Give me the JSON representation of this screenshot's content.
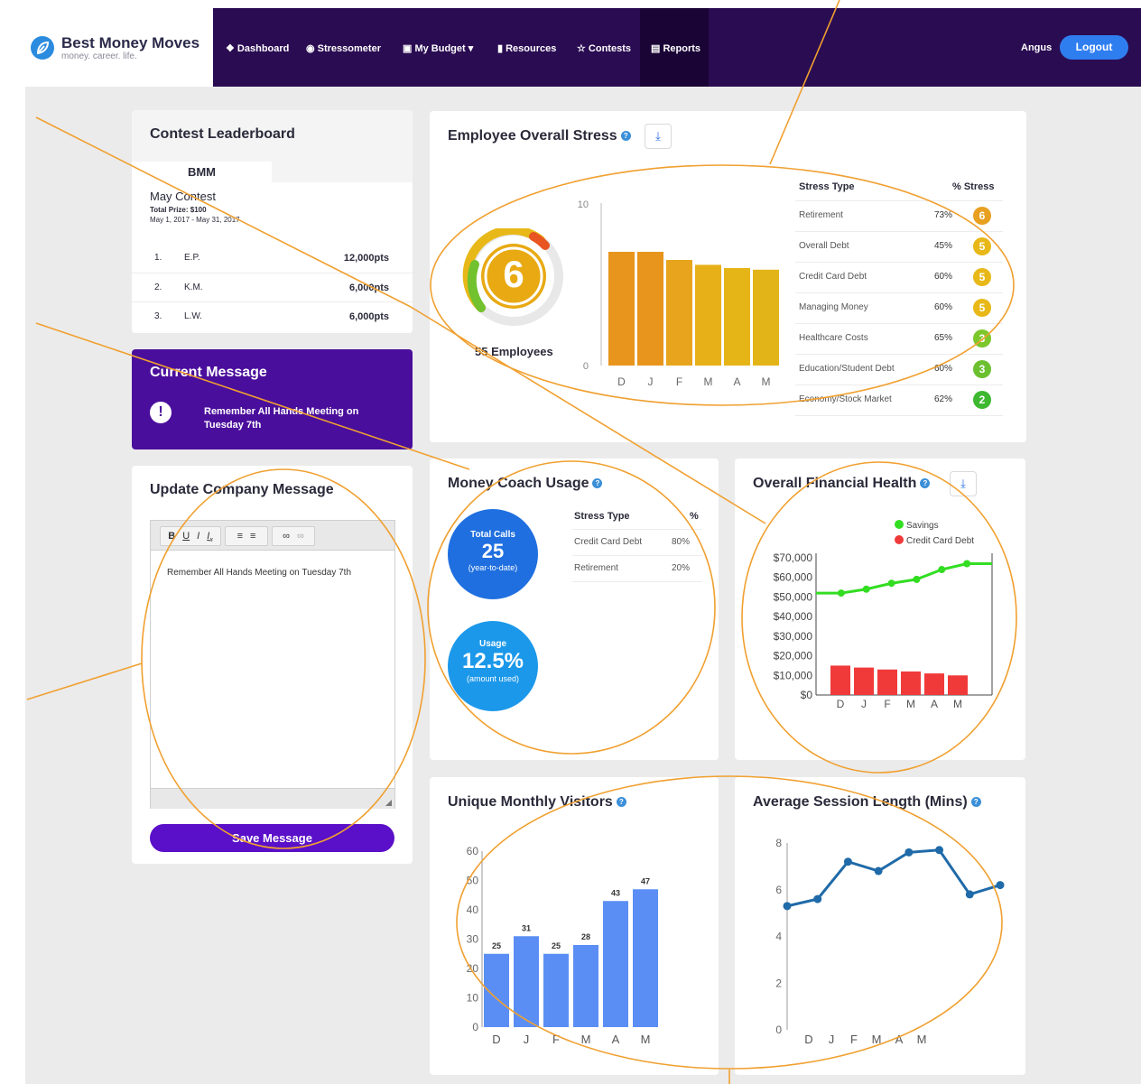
{
  "brand": {
    "name": "Best Money Moves",
    "tagline": "money. career. life."
  },
  "nav": {
    "items": [
      "Dashboard",
      "Stressometer",
      "My Budget",
      "Resources",
      "Contests",
      "Reports"
    ],
    "user": "Angus",
    "logout": "Logout"
  },
  "leaderboard": {
    "title": "Contest Leaderboard",
    "tab": "BMM",
    "contest_name": "May Contest",
    "prize": "Total Prize: $100",
    "dates": "May 1, 2017 - May 31, 2017",
    "rows": [
      {
        "rank": "1.",
        "name": "E.P.",
        "pts": "12,000pts"
      },
      {
        "rank": "2.",
        "name": "K.M.",
        "pts": "6,000pts"
      },
      {
        "rank": "3.",
        "name": "L.W.",
        "pts": "6,000pts"
      }
    ]
  },
  "current_message": {
    "title": "Current Message",
    "text": "Remember All Hands Meeting on Tuesday 7th"
  },
  "update_message": {
    "title": "Update Company Message",
    "toolbar": [
      "B",
      "U",
      "I",
      "Ix",
      "ol",
      "ul",
      "link",
      "unlink"
    ],
    "body": "Remember All Hands Meeting on Tuesday 7th",
    "save": "Save Message"
  },
  "stress": {
    "title": "Employee Overall Stress",
    "score": "6",
    "employees": "55 Employees",
    "table_headers": {
      "type": "Stress Type",
      "pct": "% Stress"
    },
    "rows": [
      {
        "type": "Retirement",
        "pct": "73%",
        "level": "6",
        "color": "#e8a020"
      },
      {
        "type": "Overall Debt",
        "pct": "45%",
        "level": "5",
        "color": "#e8b818"
      },
      {
        "type": "Credit Card Debt",
        "pct": "60%",
        "level": "5",
        "color": "#e8b818"
      },
      {
        "type": "Managing Money",
        "pct": "60%",
        "level": "5",
        "color": "#e8b818"
      },
      {
        "type": "Healthcare Costs",
        "pct": "65%",
        "level": "3",
        "color": "#7cc72c"
      },
      {
        "type": "Education/Student Debt",
        "pct": "60%",
        "level": "3",
        "color": "#6cc030"
      },
      {
        "type": "Economy/Stock Market",
        "pct": "62%",
        "level": "2",
        "color": "#3eb830"
      }
    ],
    "chart_data": {
      "type": "bar",
      "categories": [
        "D",
        "J",
        "F",
        "M",
        "A",
        "M"
      ],
      "values": [
        7,
        7,
        6.5,
        6.2,
        6,
        5.9
      ],
      "ylim": [
        0,
        10
      ],
      "yticks": [
        "0",
        "10"
      ],
      "colors": [
        "#e8951e",
        "#e8951e",
        "#e8a41c",
        "#e8b018",
        "#e5b518",
        "#e3b418"
      ]
    }
  },
  "money_coach": {
    "title": "Money Coach Usage",
    "calls": {
      "label": "Total Calls",
      "value": "25",
      "sub": "(year-to-date)"
    },
    "usage": {
      "label": "Usage",
      "value": "12.5%",
      "sub": "(amount used)"
    },
    "headers": {
      "type": "Stress Type",
      "pct": "%"
    },
    "rows": [
      {
        "type": "Credit Card Debt",
        "pct": "80%"
      },
      {
        "type": "Retirement",
        "pct": "20%"
      }
    ]
  },
  "financial_health": {
    "title": "Overall Financial Health",
    "chart_data": {
      "type": "line",
      "categories": [
        "D",
        "J",
        "F",
        "M",
        "A",
        "M"
      ],
      "series": [
        {
          "name": "Savings",
          "values": [
            52000,
            52000,
            54000,
            57000,
            59000,
            64000,
            67000,
            67000
          ],
          "color": "#33dd22"
        },
        {
          "name": "Credit Card Debt",
          "values": [
            15000,
            14000,
            13000,
            12000,
            11000,
            10000
          ],
          "color": "#f03a3a"
        }
      ],
      "yticks": [
        "$0",
        "$10,000",
        "$20,000",
        "$30,000",
        "$40,000",
        "$50,000",
        "$60,000",
        "$70,000"
      ],
      "ylim": [
        0,
        70000
      ],
      "legend": "top-right"
    }
  },
  "visitors": {
    "title": "Unique Monthly Visitors",
    "chart_data": {
      "type": "bar",
      "categories": [
        "D",
        "J",
        "F",
        "M",
        "A",
        "M"
      ],
      "values": [
        25,
        31,
        25,
        28,
        43,
        47
      ],
      "labels": [
        "25",
        "31",
        "25",
        "28",
        "43",
        "47"
      ],
      "yticks": [
        "0",
        "10",
        "20",
        "30",
        "40",
        "50",
        "60"
      ],
      "ylim": [
        0,
        60
      ],
      "color": "#5b8ef5"
    }
  },
  "session": {
    "title": "Average Session Length (Mins)",
    "chart_data": {
      "type": "line",
      "categories": [
        "D",
        "J",
        "F",
        "M",
        "A",
        "M"
      ],
      "values": [
        5.3,
        5.6,
        7.2,
        6.8,
        7.6,
        7.7,
        5.8,
        6.2
      ],
      "yticks": [
        "0",
        "2",
        "4",
        "6",
        "8"
      ],
      "ylim": [
        0,
        8
      ],
      "color": "#1f6aa8"
    }
  }
}
